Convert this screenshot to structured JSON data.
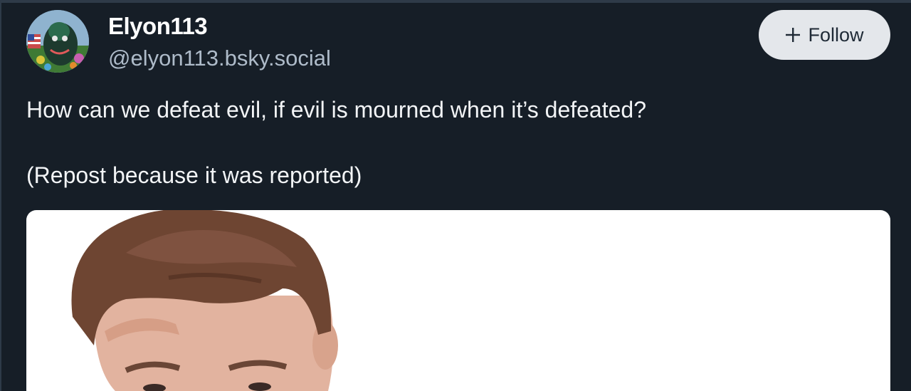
{
  "author": {
    "display_name": "Elyon113",
    "handle": "@elyon113.bsky.social",
    "avatar_icon": "user-avatar"
  },
  "follow_button": {
    "label": "Follow",
    "icon": "plus-icon"
  },
  "post": {
    "line1": "How can we defeat evil, if evil is mourned when it’s defeated?",
    "line2": "(Repost because it was reported)"
  },
  "colors": {
    "background": "#161e27",
    "button_bg": "#e4e7eb",
    "handle_text": "#aebbc9"
  }
}
